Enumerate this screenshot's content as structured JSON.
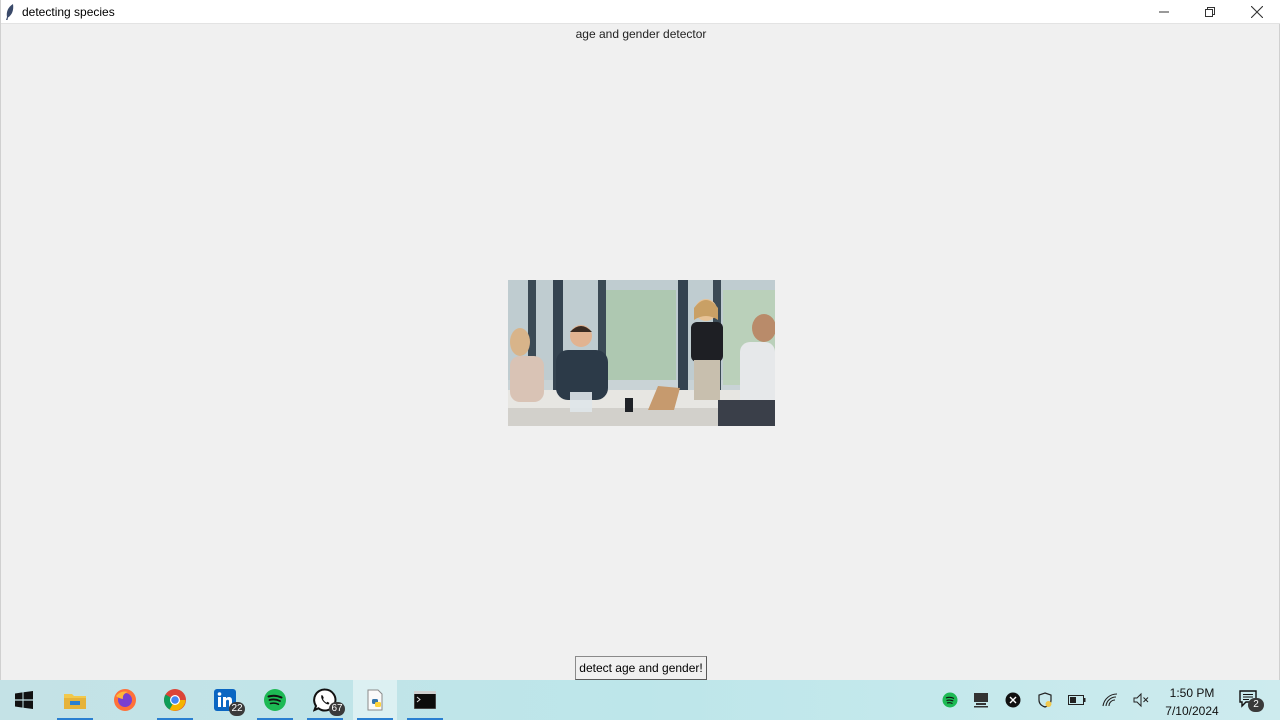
{
  "window": {
    "title": "detecting species",
    "heading": "age and gender detector",
    "photo_alt": "detect image",
    "button_label": "detect age and gender!"
  },
  "taskbar": {
    "apps": [
      {
        "name": "start-icon"
      },
      {
        "name": "file-explorer-icon"
      },
      {
        "name": "firefox-icon"
      },
      {
        "name": "chrome-icon"
      },
      {
        "name": "linkedin-icon",
        "badge": "22"
      },
      {
        "name": "spotify-icon"
      },
      {
        "name": "whatsapp-icon",
        "badge": "67"
      },
      {
        "name": "python-app-icon"
      },
      {
        "name": "terminal-icon"
      }
    ],
    "clock_time": "1:50 PM",
    "clock_date": "7/10/2024",
    "notifications_count": "2"
  },
  "colors": {
    "window_bg": "#f0f0f0",
    "taskbar_bg": "#bde6ea",
    "accent": "#2a7fd1"
  }
}
